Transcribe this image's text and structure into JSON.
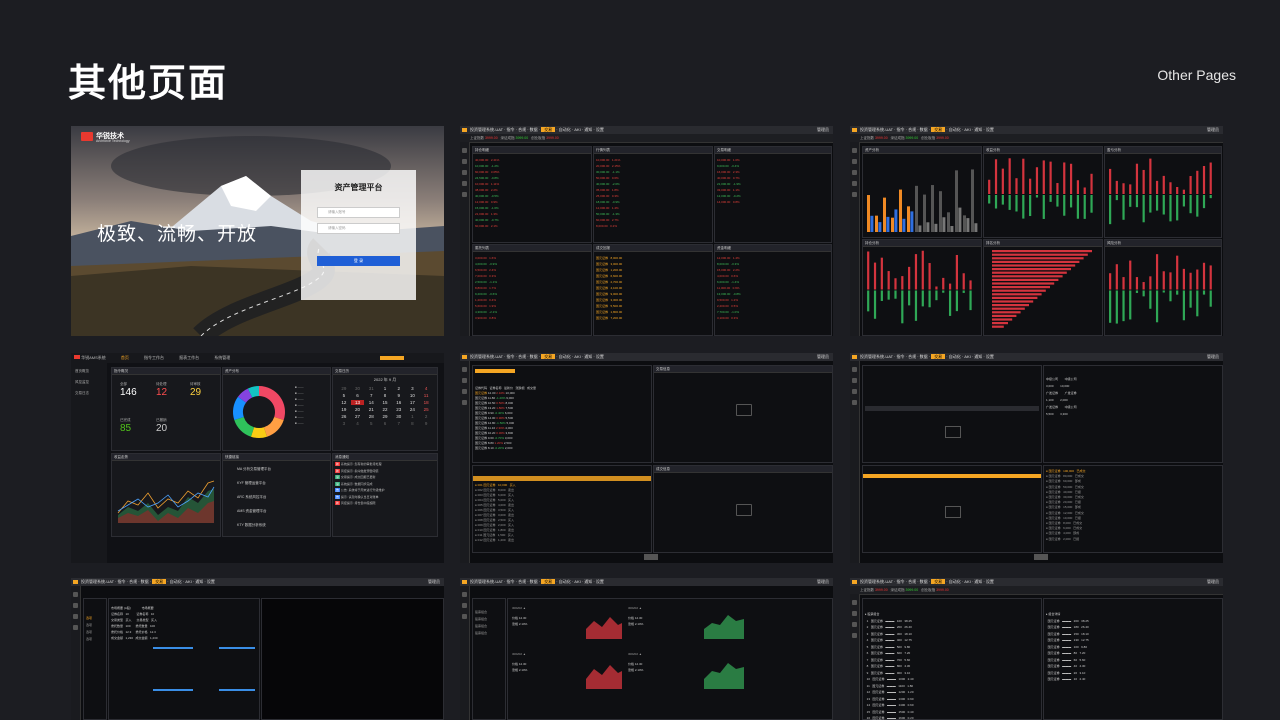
{
  "header": {
    "title": "其他页面",
    "subtitle": "Other Pages"
  },
  "login": {
    "brand_name": "华锐技术",
    "brand_en": "Archforce Technology",
    "slogan": "极致、流畅、开放",
    "form_title": "资产管理平台",
    "username_placeholder": "请输入账号",
    "password_placeholder": "请输入密码",
    "login_button": "登 录"
  },
  "trading": {
    "app_title": "投资管理系统-UAT",
    "menu": [
      "指令",
      "合规",
      "数据",
      "交易",
      "自动化",
      "AKI",
      "通知",
      "设置"
    ],
    "active_menu": "交易",
    "user": "管理员",
    "quote_items": [
      "上证指数",
      "3999.00",
      "深证成指",
      "3999.00",
      "创业板指",
      "3999.00"
    ]
  },
  "dashboard": {
    "brand": "华锐AMS系统",
    "nav": [
      "首页",
      "指令工作台",
      "报表工作台",
      "系统管理"
    ],
    "active_nav": "首页",
    "side_items": [
      "首页概览",
      "风控监控",
      "交易日志"
    ],
    "stats_title": "指令概况",
    "stats": [
      {
        "label": "全部",
        "value": "146",
        "color": "#ffffff"
      },
      {
        "label": "待处理",
        "value": "12",
        "color": "#ff4d4f"
      },
      {
        "label": "待审核",
        "value": "29",
        "color": "#ffd23f"
      },
      {
        "label": "已完成",
        "value": "85",
        "color": "#52c41a"
      },
      {
        "label": "已撤销",
        "value": "20",
        "color": "#cccccc"
      }
    ],
    "donut_title": "资产分布",
    "donut_colors": [
      "#f04864",
      "#ff9f43",
      "#facc14",
      "#2fc25b",
      "#1890ff",
      "#8543e0",
      "#13c2c2"
    ],
    "calendar_title": "交易日历",
    "calendar_header": "2022 年 9 月",
    "calendar_days": [
      "29",
      "30",
      "31",
      "1",
      "2",
      "3",
      "4",
      "5",
      "6",
      "7",
      "8",
      "9",
      "10",
      "11",
      "12",
      "13",
      "14",
      "15",
      "16",
      "17",
      "18",
      "19",
      "20",
      "21",
      "22",
      "23",
      "24",
      "25",
      "26",
      "27",
      "28",
      "29",
      "30",
      "1",
      "2",
      "3",
      "4",
      "5",
      "6",
      "7",
      "8",
      "9"
    ],
    "chart_title": "收益走势",
    "list_title": "快捷链接",
    "list_items": [
      "MA 分析交易管理平台",
      "KYF 管理运营平台",
      "ARC 系统风控平台",
      "AMS 资金管理平台",
      "KTY 数据分析系统"
    ],
    "msg_title": "消息通知",
    "messages": [
      "系统提示: 您有新的审批待处理",
      "风控提示: 指令触发预警阈值",
      "交易提示: 成交回报已更新",
      "系统提示: 数据同步完成",
      "公告: 系统将于周末进行升级维护",
      "提示: 请及时确认当日对账单",
      "风控提示: 持仓集中度超限"
    ]
  }
}
